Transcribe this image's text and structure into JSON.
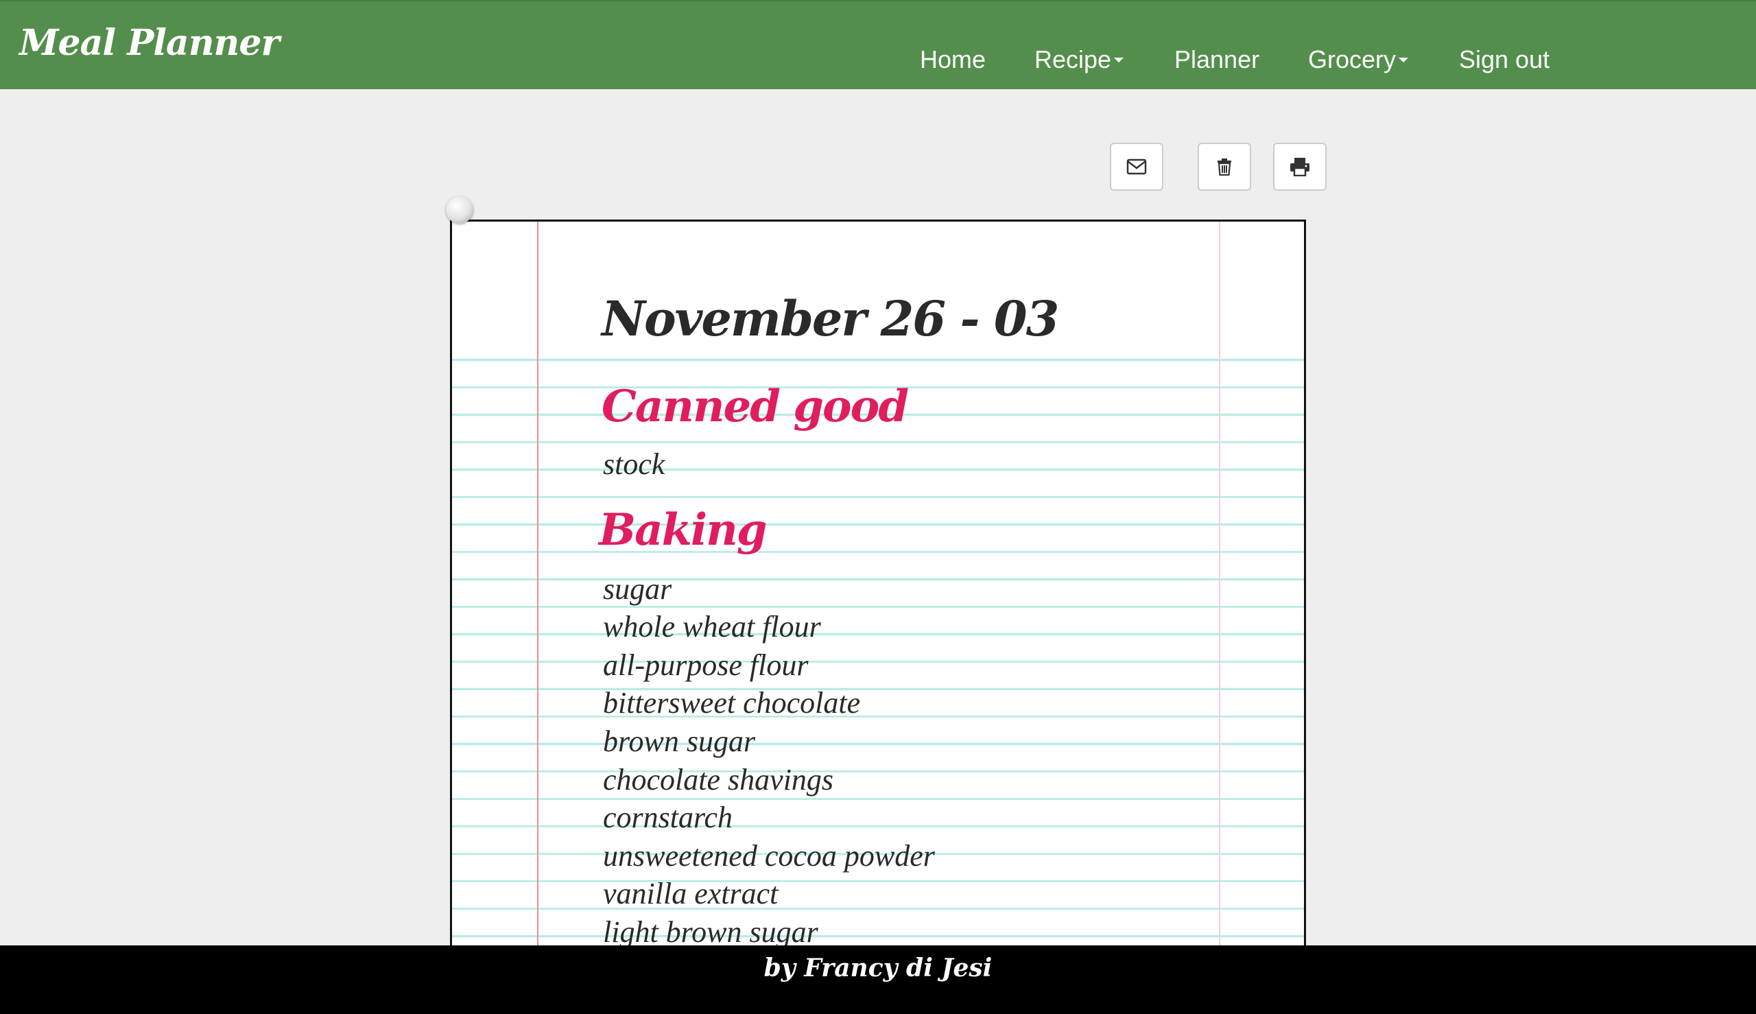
{
  "navbar": {
    "brand": "Meal Planner",
    "items": [
      {
        "label": "Home",
        "dropdown": false
      },
      {
        "label": "Recipe",
        "dropdown": true
      },
      {
        "label": "Planner",
        "dropdown": false
      },
      {
        "label": "Grocery",
        "dropdown": true
      },
      {
        "label": "Sign out",
        "dropdown": false
      }
    ],
    "color": "#548e4c"
  },
  "toolbar": {
    "buttons": [
      {
        "icon": "envelope-icon",
        "action": "email"
      },
      {
        "icon": "trash-icon",
        "action": "delete"
      },
      {
        "icon": "printer-icon",
        "action": "print"
      }
    ]
  },
  "grocery_list": {
    "week_title": "November 26 - 03",
    "categories": [
      {
        "name": "Canned good",
        "items": [
          "stock"
        ]
      },
      {
        "name": "Baking",
        "items": [
          "sugar",
          "whole wheat flour",
          "all-purpose flour",
          "bittersweet chocolate",
          "brown sugar",
          "chocolate shavings",
          "cornstarch",
          "unsweetened cocoa powder",
          "vanilla extract",
          "light brown sugar"
        ]
      }
    ],
    "category_color": "#e01d5d"
  },
  "footer": {
    "text": "by Francy di Jesi"
  }
}
